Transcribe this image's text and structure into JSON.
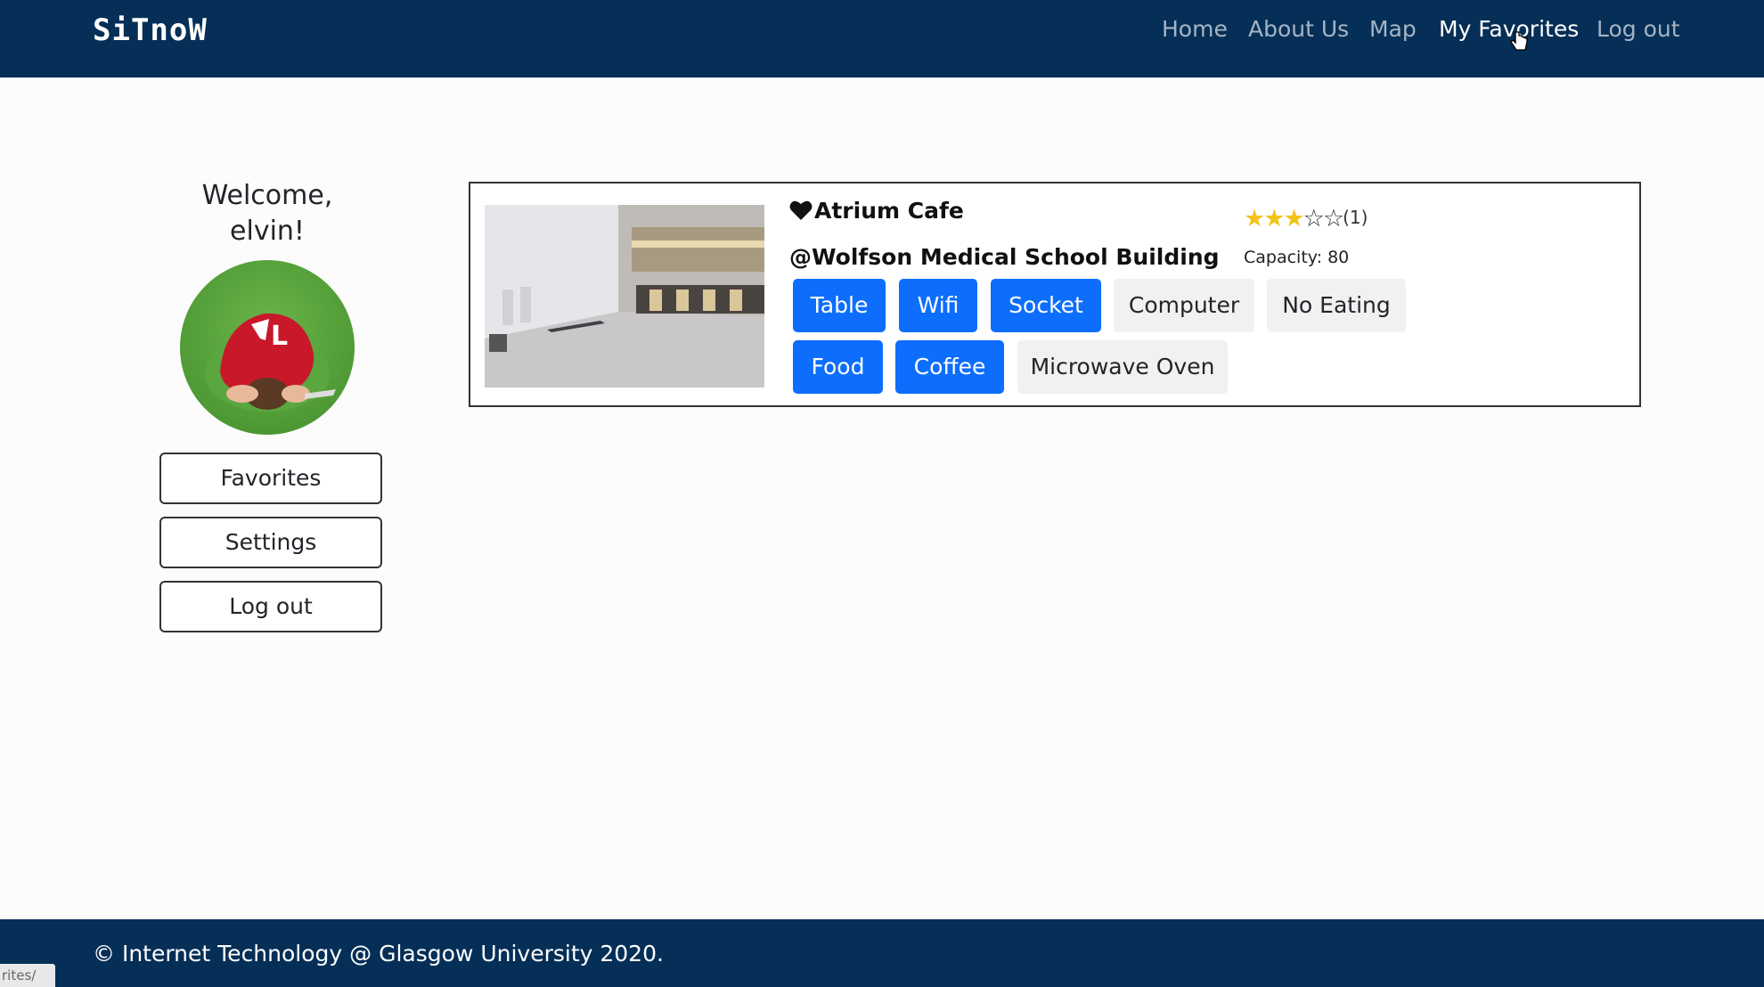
{
  "nav": {
    "brand": "SiTnoW",
    "links": [
      "Home",
      "About Us",
      "Map",
      "My Favorites",
      "Log out"
    ],
    "active": "My Favorites"
  },
  "sidebar": {
    "welcome_line1": "Welcome,",
    "welcome_line2": "elvin!",
    "buttons": [
      "Favorites",
      "Settings",
      "Log out"
    ]
  },
  "card": {
    "name": "Atrium Cafe",
    "building": "@Wolfson Medical School Building",
    "rating": 3,
    "rating_max": 5,
    "rating_count": "(1)",
    "capacity": "Capacity: 80",
    "tags": [
      {
        "label": "Table",
        "active": true
      },
      {
        "label": "Wifi",
        "active": true
      },
      {
        "label": "Socket",
        "active": true
      },
      {
        "label": "Computer",
        "active": false
      },
      {
        "label": "No Eating",
        "active": false
      },
      {
        "label": "Food",
        "active": true
      },
      {
        "label": "Coffee",
        "active": true
      },
      {
        "label": "Microwave Oven",
        "active": false
      }
    ]
  },
  "footer": {
    "text": "© Internet Technology @ Glasgow University 2020."
  },
  "status_bar": {
    "url_fragment": "rites/"
  },
  "colors": {
    "navbar_bg": "#062f57",
    "tag_active": "#0d6efd",
    "tag_inactive": "#f1f1f1",
    "star": "#f2c418"
  }
}
